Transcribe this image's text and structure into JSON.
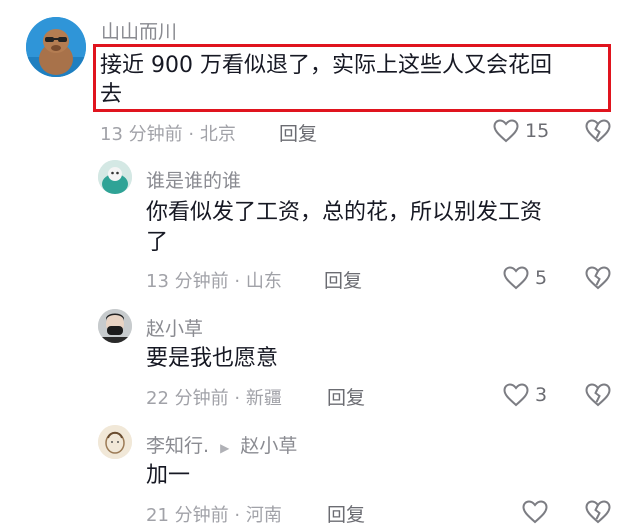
{
  "comments": [
    {
      "username": "山山而川",
      "text_line1": "接近 900 万看似退了，实际上这些人又会花回",
      "text_line2": "去",
      "time": "13 分钟前",
      "location": "北京",
      "reply_label": "回复",
      "likes": "15",
      "avatar_icon": "capybara-avatar",
      "accent_color": "#e0141e"
    },
    {
      "username": "谁是谁的谁",
      "text_line1": "你看似发了工资，总的花，所以别发工资",
      "text_line2": "了",
      "time": "13 分钟前",
      "location": "山东",
      "reply_label": "回复",
      "likes": "5",
      "avatar_icon": "teal-avatar"
    },
    {
      "username": "赵小草",
      "text": "要是我也愿意",
      "time": "22 分钟前",
      "location": "新疆",
      "reply_label": "回复",
      "likes": "3",
      "avatar_icon": "masked-person-avatar"
    },
    {
      "username": "李知行.",
      "reply_to": "赵小草",
      "text": "加一",
      "time": "21 分钟前",
      "location": "河南",
      "reply_label": "回复",
      "likes": "",
      "avatar_icon": "sketch-avatar"
    }
  ]
}
